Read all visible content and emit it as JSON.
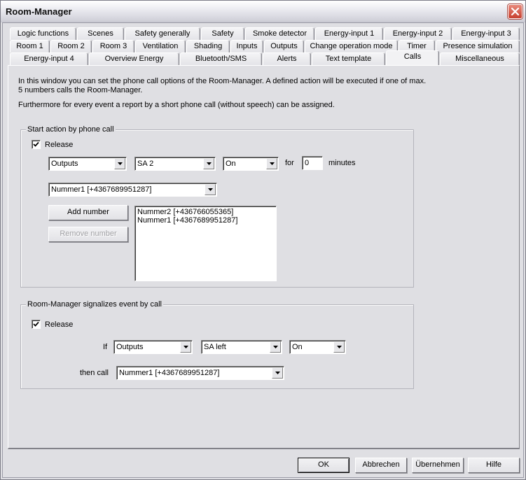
{
  "window": {
    "title": "Room-Manager",
    "close_icon": "close-icon"
  },
  "tabs": {
    "row1": [
      "Logic functions",
      "Scenes",
      "Safety generally",
      "Safety",
      "Smoke detector",
      "Energy-input 1",
      "Energy-input 2",
      "Energy-input 3"
    ],
    "row2": [
      "Room 1",
      "Room 2",
      "Room 3",
      "Ventilation",
      "Shading",
      "Inputs",
      "Outputs",
      "Change operation mode",
      "Timer",
      "Presence simulation"
    ],
    "row3": [
      "Energy-input 4",
      "Overview Energy",
      "Bluetooth/SMS",
      "Alerts",
      "Text template",
      "Calls",
      "Miscellaneous"
    ],
    "active": "Calls"
  },
  "intro": {
    "line1": "In this window you can set the phone call options of the Room-Manager. A defined action will be executed if one of max.",
    "line2": "5 numbers calls the Room-Manager.",
    "line3": "Furthermore for every event a report by a short phone call (without speech) can be assigned."
  },
  "start_action": {
    "legend": "Start action by phone call",
    "release_label": "Release",
    "release_checked": true,
    "combo_type": "Outputs",
    "combo_output": "SA 2",
    "combo_state": "On",
    "for_label": "for",
    "duration_value": "0",
    "minutes_label": "minutes",
    "number_combo": "Nummer1 [+4367689951287]",
    "add_number_label": "Add number",
    "remove_number_label": "Remove number",
    "numbers": [
      "Nummer2 [+436766055365]",
      "Nummer1 [+4367689951287]"
    ]
  },
  "signal_event": {
    "legend": "Room-Manager signalizes event by call",
    "release_label": "Release",
    "release_checked": true,
    "if_label": "If",
    "combo_type": "Outputs",
    "combo_output": "SA left",
    "combo_state": "On",
    "then_call_label": "then call",
    "call_combo": "Nummer1 [+4367689951287]"
  },
  "footer": {
    "ok_label": "OK",
    "cancel_label": "Abbrechen",
    "apply_label": "Übernehmen",
    "help_label": "Hilfe"
  }
}
